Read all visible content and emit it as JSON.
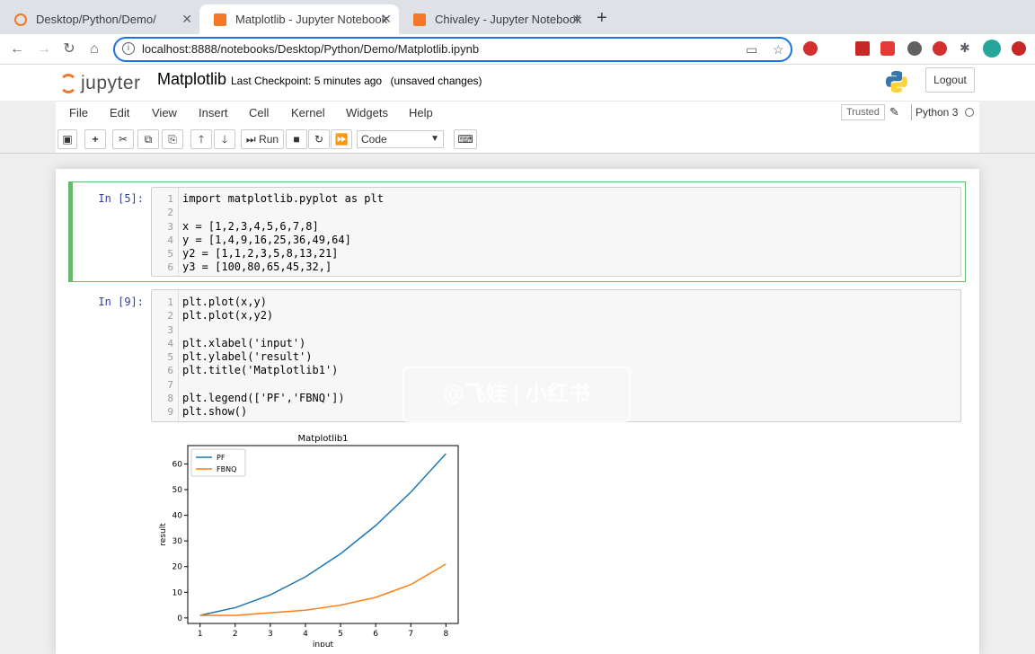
{
  "browser": {
    "tabs": [
      {
        "label": "Desktop/Python/Demo/",
        "active": false
      },
      {
        "label": "Matplotlib - Jupyter Notebook",
        "active": true
      },
      {
        "label": "Chivaley - Jupyter Notebook",
        "active": false
      }
    ],
    "url": "localhost:8888/notebooks/Desktop/Python/Demo/Matplotlib.ipynb"
  },
  "header": {
    "logo_text": "jupyter",
    "notebook_title": "Matplotlib",
    "checkpoint": "Last Checkpoint: 5 minutes ago",
    "unsaved": "(unsaved changes)",
    "logout": "Logout"
  },
  "menu": [
    "File",
    "Edit",
    "View",
    "Insert",
    "Cell",
    "Kernel",
    "Widgets",
    "Help"
  ],
  "status": {
    "trusted": "Trusted",
    "kernel": "Python 3"
  },
  "toolbar": {
    "run_label": "Run",
    "cell_type": "Code"
  },
  "cells": [
    {
      "prompt": "In [5]:",
      "lines": [
        "import matplotlib.pyplot as plt",
        "",
        "x = [1,2,3,4,5,6,7,8]",
        "y = [1,4,9,16,25,36,49,64]",
        "y2 = [1,1,2,3,5,8,13,21]",
        "y3 = [100,80,65,45,32,]"
      ]
    },
    {
      "prompt": "In [9]:",
      "lines": [
        "plt.plot(x,y)",
        "plt.plot(x,y2)",
        "",
        "plt.xlabel('input')",
        "plt.ylabel('result')",
        "plt.title('Matplotlib1')",
        "",
        "plt.legend(['PF','FBNQ'])",
        "plt.show()"
      ]
    }
  ],
  "watermark": "@飞娃 | 小红书",
  "chart_data": {
    "type": "line",
    "title": "Matplotlib1",
    "xlabel": "input",
    "ylabel": "result",
    "x": [
      1,
      2,
      3,
      4,
      5,
      6,
      7,
      8
    ],
    "series": [
      {
        "name": "PF",
        "values": [
          1,
          4,
          9,
          16,
          25,
          36,
          49,
          64
        ],
        "color": "#1f77b4"
      },
      {
        "name": "FBNQ",
        "values": [
          1,
          1,
          2,
          3,
          5,
          8,
          13,
          21
        ],
        "color": "#ff7f0e"
      }
    ],
    "xticks": [
      1,
      2,
      3,
      4,
      5,
      6,
      7,
      8
    ],
    "yticks": [
      0,
      10,
      20,
      30,
      40,
      50,
      60
    ],
    "xlim": [
      0.65,
      8.35
    ],
    "ylim": [
      -2.15,
      67.15
    ],
    "legend": "top-left",
    "grid": false
  }
}
